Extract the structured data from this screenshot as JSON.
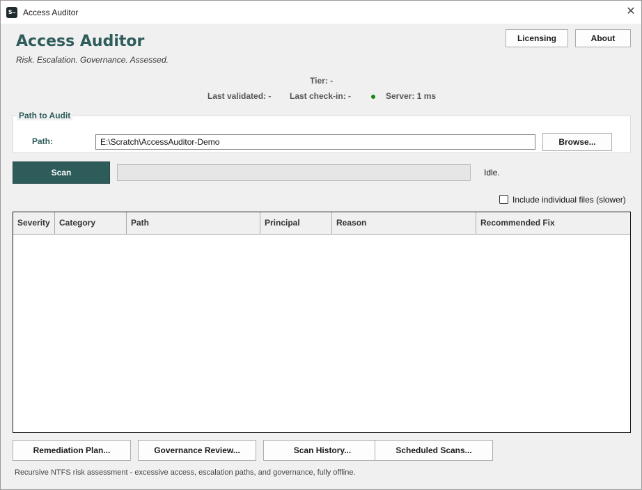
{
  "window": {
    "title": "Access Auditor",
    "icon_text": "S‒",
    "close_glyph": "✕"
  },
  "header": {
    "app_title": "Access Auditor",
    "tagline": "Risk. Escalation. Governance. Assessed.",
    "licensing_label": "Licensing",
    "about_label": "About"
  },
  "status": {
    "tier": "Tier: -",
    "last_validated": "Last validated: -",
    "last_checkin": "Last check-in: -",
    "server": "Server: 1 ms",
    "server_status_color": "#138a13"
  },
  "path_group": {
    "title": "Path to Audit",
    "path_label": "Path:",
    "path_value": "E:\\Scratch\\AccessAuditor-Demo",
    "browse_label": "Browse..."
  },
  "scan": {
    "scan_label": "Scan",
    "progress_percent": 0,
    "status_text": "Idle.",
    "include_files_label": "Include individual files (slower)",
    "include_files_checked": false
  },
  "table": {
    "columns": [
      "Severity",
      "Category",
      "Path",
      "Principal",
      "Reason",
      "Recommended Fix"
    ],
    "rows": []
  },
  "actions": {
    "remediation": "Remediation Plan...",
    "governance": "Governance Review...",
    "history": "Scan History...",
    "scheduled": "Scheduled Scans..."
  },
  "footer": {
    "text": "Recursive NTFS risk assessment - excessive access, escalation paths, and governance, fully offline."
  },
  "colors": {
    "accent": "#2e5c5a",
    "window_bg": "#f0f0f0"
  }
}
